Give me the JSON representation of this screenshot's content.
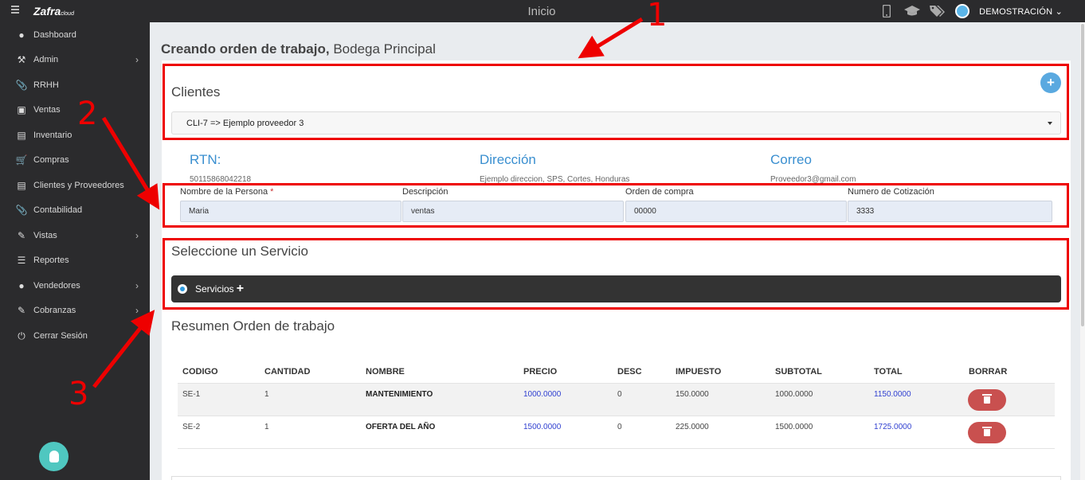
{
  "topbar": {
    "logo": "Zafra",
    "logo_suffix": "cloud",
    "title": "Inicio",
    "user_name": "DEMOSTRACIÓN"
  },
  "sidebar": {
    "items": [
      {
        "label": "Dashboard",
        "icon": "palette-icon",
        "has_chevron": false
      },
      {
        "label": "Admin",
        "icon": "wrench-icon",
        "has_chevron": true
      },
      {
        "label": "RRHH",
        "icon": "paperclip-icon",
        "has_chevron": false
      },
      {
        "label": "Ventas",
        "icon": "money-icon",
        "has_chevron": false
      },
      {
        "label": "Inventario",
        "icon": "book-icon",
        "has_chevron": false
      },
      {
        "label": "Compras",
        "icon": "cart-icon",
        "has_chevron": false
      },
      {
        "label": "Clientes y Proveedores",
        "icon": "book-icon",
        "has_chevron": false
      },
      {
        "label": "Contabilidad",
        "icon": "paperclip-icon",
        "has_chevron": false
      },
      {
        "label": "Vistas",
        "icon": "edit-icon",
        "has_chevron": true
      },
      {
        "label": "Reportes",
        "icon": "list-icon",
        "has_chevron": false
      },
      {
        "label": "Vendedores",
        "icon": "user-icon",
        "has_chevron": true
      },
      {
        "label": "Cobranzas",
        "icon": "edit-icon",
        "has_chevron": true
      },
      {
        "label": "Cerrar Sesión",
        "icon": "power-icon",
        "has_chevron": false
      }
    ]
  },
  "page": {
    "title_bold": "Creando orden de trabajo,",
    "title_rest": "Bodega Principal"
  },
  "clientes": {
    "title": "Clientes",
    "add_label": "+",
    "selected": "CLI-7 => Ejemplo proveedor 3"
  },
  "info": {
    "rtn_label": "RTN:",
    "rtn_value": "50115868042218",
    "direccion_label": "Dirección",
    "direccion_value": "Ejemplo direccion, SPS, Cortes, Honduras",
    "correo_label": "Correo",
    "correo_value": "Proveedor3@gmail.com"
  },
  "fields": {
    "persona_label": "Nombre de la Persona",
    "persona_required": "*",
    "persona_value": "Maria",
    "descripcion_label": "Descripción",
    "descripcion_value": "ventas",
    "orden_label": "Orden de compra",
    "orden_value": "00000",
    "cotizacion_label": "Numero de Cotización",
    "cotizacion_value": "3333"
  },
  "servicio": {
    "title": "Seleccione un Servicio",
    "option_label": "Servicios",
    "plus": "+"
  },
  "resumen": {
    "title": "Resumen Orden de trabajo",
    "columns": [
      "CODIGO",
      "CANTIDAD",
      "NOMBRE",
      "PRECIO",
      "DESC",
      "IMPUESTO",
      "SUBTOTAL",
      "TOTAL",
      "BORRAR"
    ],
    "rows": [
      {
        "codigo": "SE-1",
        "cantidad": "1",
        "nombre": "MANTENIMIENTO",
        "precio": "1000.0000",
        "desc": "0",
        "impuesto": "150.0000",
        "subtotal": "1000.0000",
        "total": "1150.0000"
      },
      {
        "codigo": "SE-2",
        "cantidad": "1",
        "nombre": "OFERTA DEL AÑO",
        "precio": "1500.0000",
        "desc": "0",
        "impuesto": "225.0000",
        "subtotal": "1500.0000",
        "total": "1725.0000"
      }
    ]
  },
  "annotations": {
    "n1": "1",
    "n2": "2",
    "n3": "3",
    "color": "#e00000"
  },
  "colors": {
    "sidebar_bg": "#2b2b2d",
    "accent_blue": "#3a8fd0",
    "delete_red": "#c9504f"
  }
}
